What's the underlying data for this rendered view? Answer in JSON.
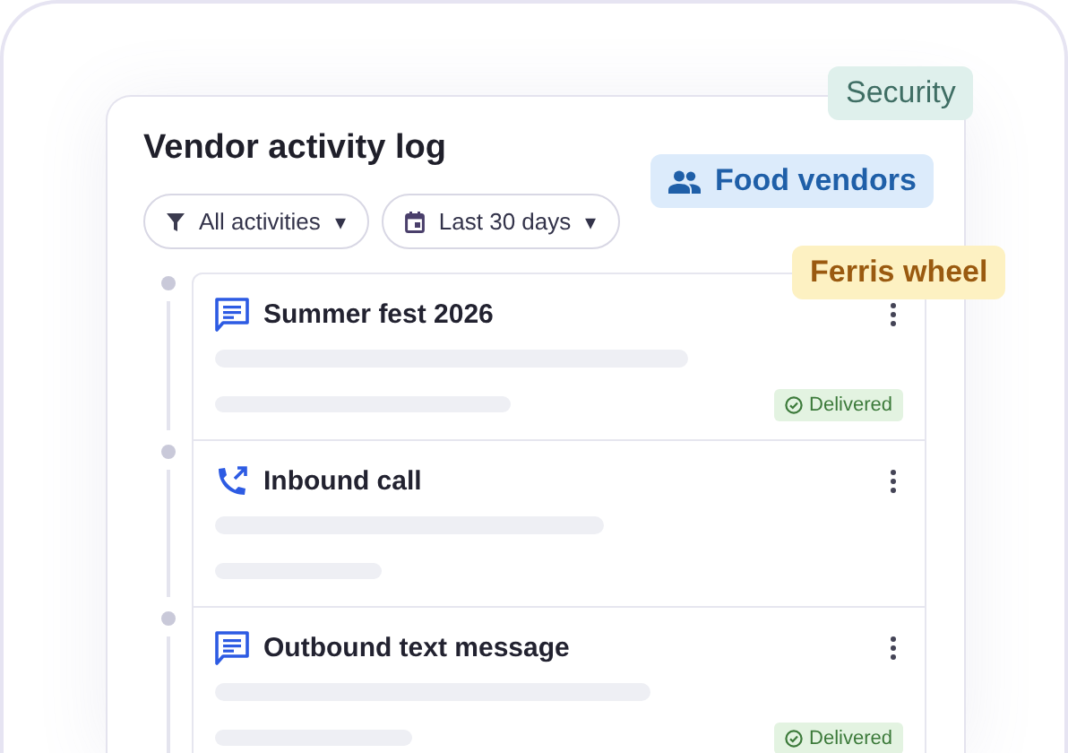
{
  "title": "Vendor activity log",
  "filters": [
    {
      "kind": "filter",
      "label": "All activities",
      "caret": "▾"
    },
    {
      "kind": "calendar",
      "label": "Last 30 days",
      "caret": "▾"
    }
  ],
  "tags": [
    {
      "kind": "plain",
      "label": "Security",
      "color": "#dff0ec"
    },
    {
      "kind": "people",
      "label": "Food vendors",
      "color": "#dcebfb"
    },
    {
      "kind": "plain",
      "label": "Ferris wheel",
      "color": "#fdf1c2"
    }
  ],
  "items": [
    {
      "kind": "message",
      "title": "Summer fest 2026",
      "status": "Delivered"
    },
    {
      "kind": "call",
      "title": "Inbound call"
    },
    {
      "kind": "message",
      "title": "Outbound text message",
      "status": "Delivered"
    }
  ]
}
